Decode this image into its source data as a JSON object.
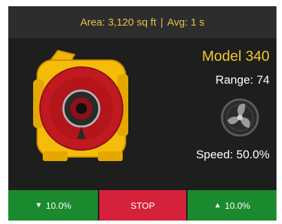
{
  "status": {
    "area": "Area: 3,120 sq ft",
    "separator": "|",
    "avg": "Avg: 1 s"
  },
  "device": {
    "model": "Model 340",
    "range": "Range: 74",
    "speed": "Speed: 50.0%",
    "fan_icon": "fan-icon",
    "image_icon": "air-mover-device-image"
  },
  "controls": {
    "down_arrow": "▼",
    "down_label": "10.0%",
    "stop_label": "STOP",
    "up_arrow": "▲",
    "up_label": "10.0%"
  },
  "colors": {
    "background": "#1e1e1e",
    "accent": "#f3c72f",
    "go": "#1b8a2e",
    "stop": "#d6213b"
  }
}
